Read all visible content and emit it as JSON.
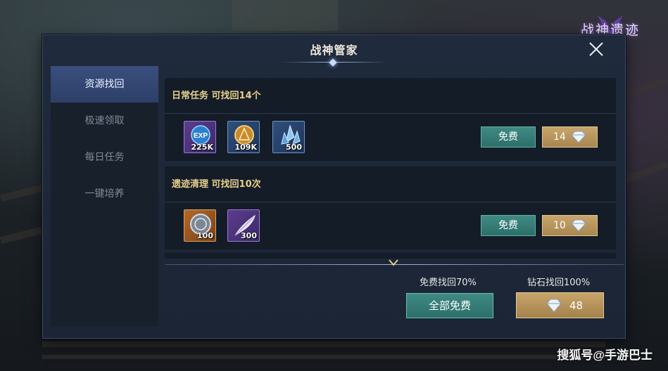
{
  "logo": {
    "text": "战神遗迹"
  },
  "watermark": "搜狐号@手游巴士",
  "dialog": {
    "title": "战神管家",
    "close_icon": "close-icon"
  },
  "sidebar": {
    "items": [
      {
        "label": "资源找回",
        "active": true
      },
      {
        "label": "极速领取",
        "active": false
      },
      {
        "label": "每日任务",
        "active": false
      },
      {
        "label": "一键培养",
        "active": false
      }
    ]
  },
  "quests": [
    {
      "title": "日常任务 可找回14个",
      "rewards": [
        {
          "icon": "exp-icon",
          "count": "225K"
        },
        {
          "icon": "gold-coin-icon",
          "count": "109K"
        },
        {
          "icon": "crystal-icon",
          "count": "500"
        }
      ],
      "free_label": "免费",
      "diamond_cost": "14"
    },
    {
      "title": "遗迹清理 可找回10次",
      "rewards": [
        {
          "icon": "silver-coin-icon",
          "count": "100"
        },
        {
          "icon": "feather-icon",
          "count": "300"
        }
      ],
      "free_label": "免费",
      "diamond_cost": "10"
    }
  ],
  "footer": {
    "free_rate_label": "免费找回70%",
    "diamond_rate_label": "钻石找回100%",
    "all_free_label": "全部免费",
    "all_diamond_cost": "48"
  },
  "colors": {
    "accent_teal": "#2d6f6a",
    "accent_gold": "#c7a56a",
    "quest_title": "#e8cf8a",
    "active_tab": "#3a4f7e"
  }
}
